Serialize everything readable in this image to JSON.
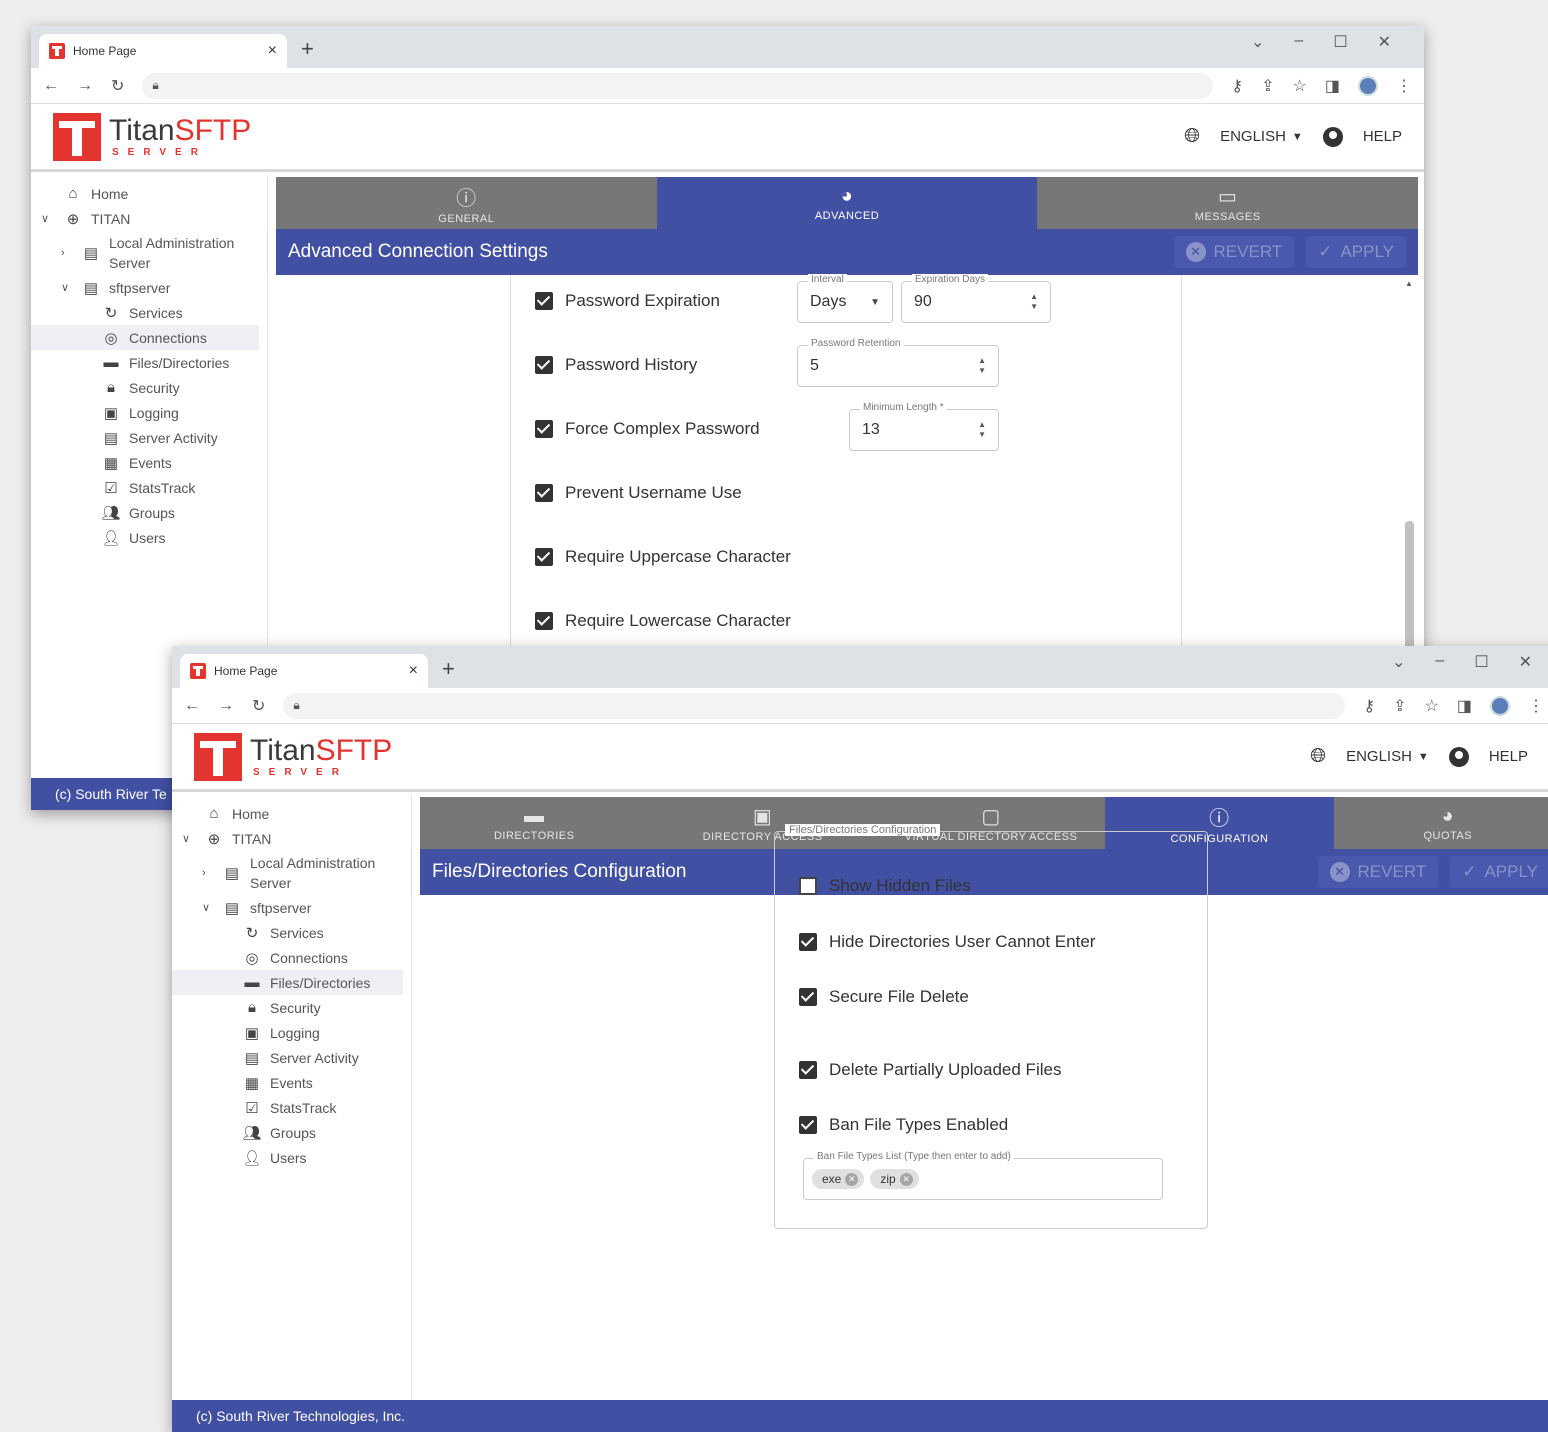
{
  "window1": {
    "tab_title": "Home Page",
    "app": {
      "name_part1": "Titan",
      "name_part2": "SFTP",
      "subtitle": "SERVER",
      "language": "ENGLISH",
      "help": "HELP"
    },
    "sidebar": [
      {
        "label": "Home",
        "icon": "home-icon"
      },
      {
        "label": "TITAN",
        "icon": "globe-icon"
      },
      {
        "label": "Local Administration Server",
        "icon": "server-icon"
      },
      {
        "label": "sftpserver",
        "icon": "server-icon"
      },
      {
        "label": "Services",
        "icon": "sync-icon"
      },
      {
        "label": "Connections",
        "icon": "connections-icon"
      },
      {
        "label": "Files/Directories",
        "icon": "folder-icon"
      },
      {
        "label": "Security",
        "icon": "lock-icon"
      },
      {
        "label": "Logging",
        "icon": "log-icon"
      },
      {
        "label": "Server Activity",
        "icon": "clipboard-icon"
      },
      {
        "label": "Events",
        "icon": "calendar-icon"
      },
      {
        "label": "StatsTrack",
        "icon": "check-square-icon"
      },
      {
        "label": "Groups",
        "icon": "groups-icon"
      },
      {
        "label": "Users",
        "icon": "user-icon"
      }
    ],
    "tabs": [
      {
        "label": "GENERAL",
        "icon": "info-icon"
      },
      {
        "label": "ADVANCED",
        "icon": "pie-icon"
      },
      {
        "label": "MESSAGES",
        "icon": "message-icon"
      }
    ],
    "page_title": "Advanced Connection Settings",
    "revert": "REVERT",
    "apply": "APPLY",
    "options": [
      {
        "label": "Password Expiration",
        "checked": true
      },
      {
        "label": "Password History",
        "checked": true
      },
      {
        "label": "Force Complex Password",
        "checked": true
      },
      {
        "label": "Prevent Username Use",
        "checked": true
      },
      {
        "label": "Require Uppercase Character",
        "checked": true
      },
      {
        "label": "Require Lowercase Character",
        "checked": true
      }
    ],
    "fields": {
      "interval_label": "Interval",
      "interval_value": "Days",
      "expiration_label": "Expiration Days",
      "expiration_value": "90",
      "retention_label": "Password Retention",
      "retention_value": "5",
      "minlen_label": "Minimum Length *",
      "minlen_value": "13"
    },
    "footer": "(c) South River Te"
  },
  "window2": {
    "tab_title": "Home Page",
    "app": {
      "name_part1": "Titan",
      "name_part2": "SFTP",
      "subtitle": "SERVER",
      "language": "ENGLISH",
      "help": "HELP"
    },
    "sidebar": [
      {
        "label": "Home",
        "icon": "home-icon"
      },
      {
        "label": "TITAN",
        "icon": "globe-icon"
      },
      {
        "label": "Local Administration Server",
        "icon": "server-icon"
      },
      {
        "label": "sftpserver",
        "icon": "server-icon"
      },
      {
        "label": "Services",
        "icon": "sync-icon"
      },
      {
        "label": "Connections",
        "icon": "connections-icon"
      },
      {
        "label": "Files/Directories",
        "icon": "folder-icon"
      },
      {
        "label": "Security",
        "icon": "lock-icon"
      },
      {
        "label": "Logging",
        "icon": "log-icon"
      },
      {
        "label": "Server Activity",
        "icon": "clipboard-icon"
      },
      {
        "label": "Events",
        "icon": "calendar-icon"
      },
      {
        "label": "StatsTrack",
        "icon": "check-square-icon"
      },
      {
        "label": "Groups",
        "icon": "groups-icon"
      },
      {
        "label": "Users",
        "icon": "user-icon"
      }
    ],
    "tabs": [
      {
        "label": "DIRECTORIES",
        "icon": "folder-icon"
      },
      {
        "label": "DIRECTORY ACCESS",
        "icon": "folder-access-icon"
      },
      {
        "label": "VIRTUAL DIRECTORY ACCESS",
        "icon": "virtual-folder-icon"
      },
      {
        "label": "CONFIGURATION",
        "icon": "info-icon"
      },
      {
        "label": "QUOTAS",
        "icon": "pie-icon"
      }
    ],
    "page_title": "Files/Directories Configuration",
    "revert": "REVERT",
    "apply": "APPLY",
    "group_legend": "Files/Directories Configuration",
    "options": [
      {
        "label": "Show Hidden Files",
        "checked": false
      },
      {
        "label": "Hide Directories User Cannot Enter",
        "checked": true
      },
      {
        "label": "Secure File Delete",
        "checked": true
      },
      {
        "label": "Delete Partially Uploaded Files",
        "checked": true
      },
      {
        "label": "Ban File Types Enabled",
        "checked": true
      }
    ],
    "ban_list_label": "Ban File Types List (Type then enter to add)",
    "ban_list": [
      "exe",
      "zip"
    ],
    "footer": "(c) South River Technologies, Inc."
  },
  "colors": {
    "primary": "#4150a3",
    "tab_inactive": "#777777",
    "brand_red": "#e3342f"
  }
}
